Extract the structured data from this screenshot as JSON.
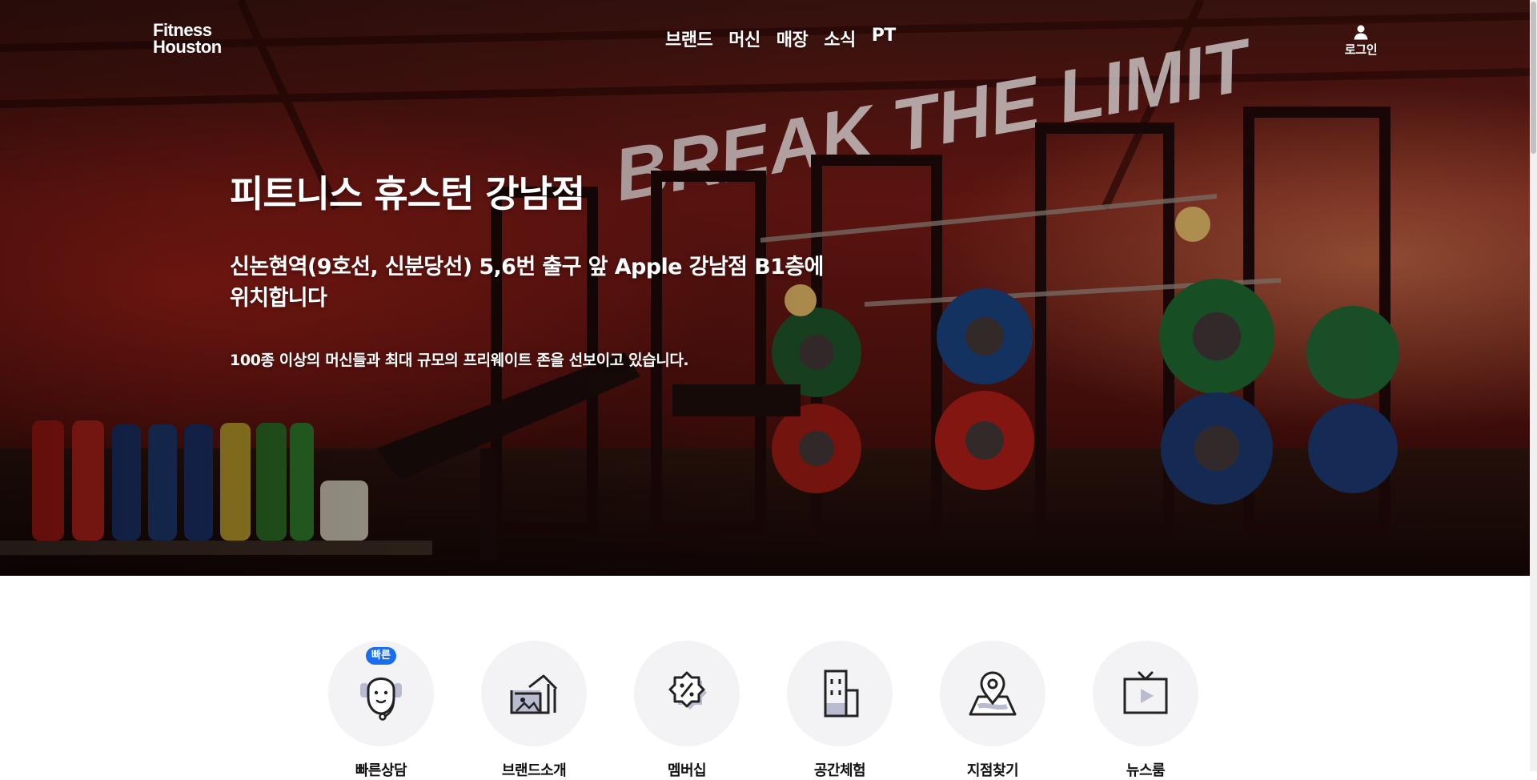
{
  "header": {
    "logo_line1": "Fitness",
    "logo_line2": "Houston",
    "nav": [
      {
        "label": "브랜드"
      },
      {
        "label": "머신"
      },
      {
        "label": "매장"
      },
      {
        "label": "소식"
      },
      {
        "label": "PT"
      }
    ],
    "login_label": "로그인",
    "login_icon": "user-icon"
  },
  "hero": {
    "title": "피트니스 휴스턴 강남점",
    "subtitle": "신논현역(9호선, 신분당선) 5,6번 출구 앞 Apple 강남점 B1층에 위치합니다",
    "description": "100종 이상의 머신들과 최대 규모의 프리웨이트 존을 선보이고 있습니다.",
    "sign_text": "BREAK THE LIMIT",
    "accent_color": "#c8141c"
  },
  "quick_menu": {
    "items": [
      {
        "label": "빠른상담",
        "icon": "headset-agent-icon",
        "badge": "빠른"
      },
      {
        "label": "브랜드소개",
        "icon": "brand-house-icon"
      },
      {
        "label": "멤버십",
        "icon": "discount-badge-icon"
      },
      {
        "label": "공간체험",
        "icon": "building-icon"
      },
      {
        "label": "지점찾기",
        "icon": "map-pin-icon"
      },
      {
        "label": "뉴스룸",
        "icon": "tv-play-icon"
      }
    ],
    "badge_color": "#1a6cf0",
    "circle_color": "#f3f3f5"
  }
}
